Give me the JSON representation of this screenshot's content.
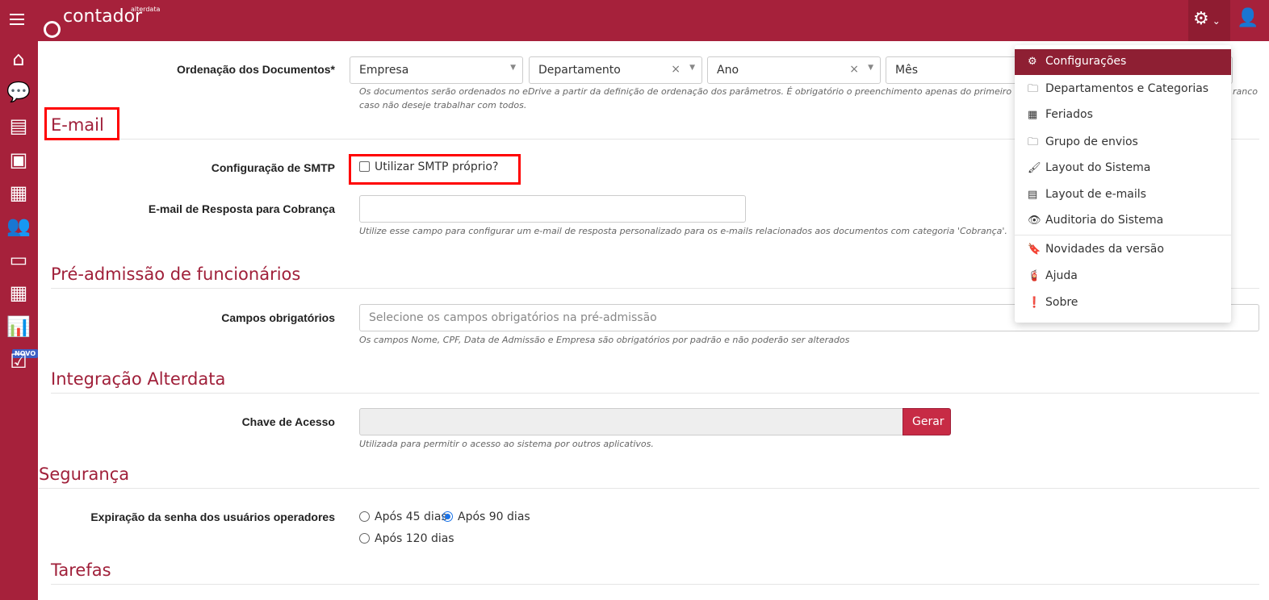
{
  "header": {
    "logo_text": "contador",
    "logo_sub": "alterdata"
  },
  "sidebar": {
    "badge_novo": "NOVO"
  },
  "ordering": {
    "label": "Ordenação dos Documentos*",
    "selects": [
      "Empresa",
      "Departamento",
      "Ano",
      "Mês"
    ],
    "help": "Os documentos serão ordenados no eDrive a partir da definição de ordenação dos parâmetros. É obrigatório o preenchimento apenas do primeiro campo",
    "help_end": "ranco",
    "help2": "caso não deseje trabalhar com todos."
  },
  "email": {
    "title": "E-mail",
    "smtp_label": "Configuração de SMTP",
    "smtp_checkbox": "Utilizar SMTP próprio?",
    "reply_label": "E-mail de Resposta para Cobrança",
    "reply_value": "",
    "reply_help": "Utilize esse campo para configurar um e-mail de resposta personalizado para os e-mails relacionados aos documentos com categoria 'Cobrança'."
  },
  "preadmissao": {
    "title": "Pré-admissão de funcionários",
    "label": "Campos obrigatórios",
    "placeholder": "Selecione os campos obrigatórios na pré-admissão",
    "help": "Os campos Nome, CPF, Data de Admissão e Empresa são obrigatórios por padrão e não poderão ser alterados"
  },
  "integracao": {
    "title": "Integração Alterdata",
    "label": "Chave de Acesso",
    "value": "",
    "button": "Gerar",
    "help": "Utilizada para permitir o acesso ao sistema por outros aplicativos."
  },
  "seguranca": {
    "title": "Segurança",
    "label": "Expiração da senha dos usuários operadores",
    "options": [
      "Após 45 dias",
      "Após 90 dias",
      "Após 120 dias"
    ],
    "selected": "Após 90 dias"
  },
  "tarefas": {
    "title": "Tarefas"
  },
  "menu": {
    "items": [
      "Configurações",
      "Departamentos e Categorias",
      "Feriados",
      "Grupo de envios",
      "Layout do Sistema",
      "Layout de e-mails",
      "Auditoria do Sistema",
      "Novidades da versão",
      "Ajuda",
      "Sobre"
    ]
  }
}
